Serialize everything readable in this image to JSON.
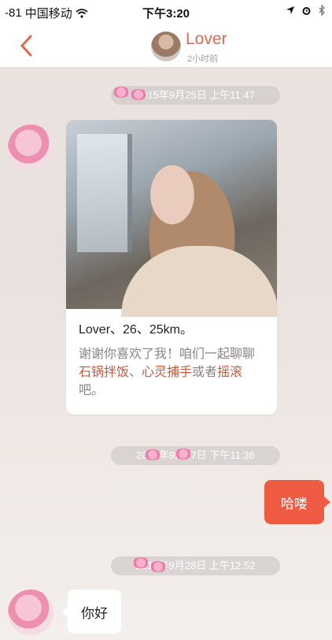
{
  "status_bar": {
    "signal": "-81",
    "carrier": "中国移动",
    "time": "下午3:20"
  },
  "header": {
    "title": "Lover",
    "subtitle": "2小时前"
  },
  "messages": {
    "timestamp_1": "2015年9月25日 上午11:47",
    "timestamp_2": "2015年9月27日 下午11:36",
    "timestamp_3": "2015年9月28日 上午12:52",
    "card_name": "Lover、26、25km。",
    "card_text_1": "谢谢你喜欢了我！咱们一起聊聊",
    "card_highlight_1": "石锅拌饭",
    "card_sep_1": "、",
    "card_highlight_2": "心灵捕手",
    "card_text_2": "或者",
    "card_highlight_3": "摇滚",
    "card_text_3": "吧。",
    "outgoing_1": "哈喽",
    "incoming_1": "你好"
  },
  "colors": {
    "accent": "#ef5a43",
    "title": "#e2674d"
  },
  "icons": {
    "back": "chevron-left-icon",
    "wifi": "wifi-icon",
    "location": "location-arrow-icon",
    "alarm": "alarm-icon",
    "bluetooth": "bluetooth-icon"
  }
}
